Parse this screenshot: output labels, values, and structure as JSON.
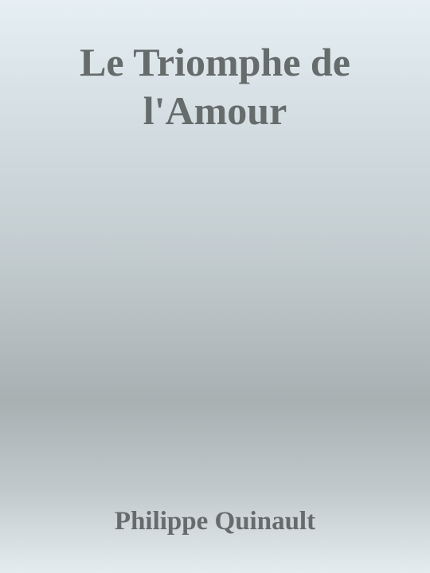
{
  "cover": {
    "title_lines": [
      "Le Triomphe de",
      "l'Amour"
    ],
    "author": "Philippe Quinault"
  }
}
